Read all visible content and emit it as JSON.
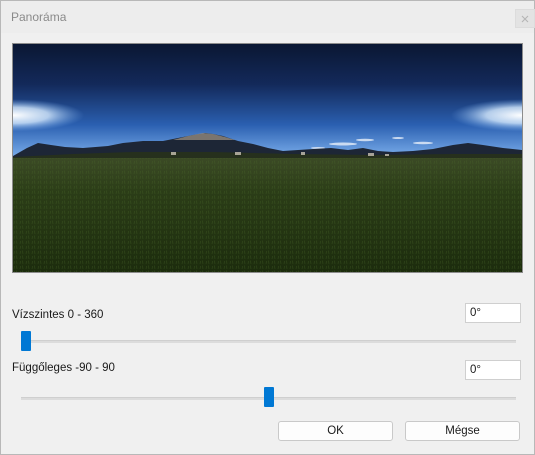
{
  "window": {
    "title": "Panoráma"
  },
  "horizontal": {
    "label": "Vízszintes 0 - 360",
    "value": "0°",
    "min": 0,
    "max": 360,
    "current": 0
  },
  "vertical": {
    "label": "Függőleges -90 - 90",
    "value": "0°",
    "min": -90,
    "max": 90,
    "current": 0
  },
  "buttons": {
    "ok": "OK",
    "cancel": "Mégse"
  },
  "colors": {
    "accent": "#0078d4"
  }
}
